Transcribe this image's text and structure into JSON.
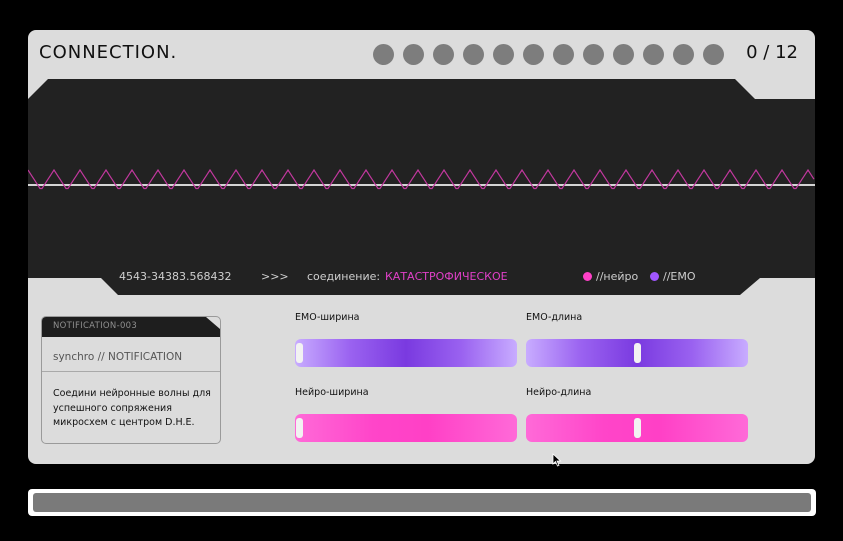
{
  "header": {
    "title": "CONNECTION.",
    "progress_dots": 12,
    "counter": "0 / 12"
  },
  "status": {
    "id": "4543-34383.568432",
    "arrows": ">>>",
    "connection_label": "соединение:",
    "connection_value": "КАТАСТРОФИЧЕСКОЕ",
    "legend": [
      {
        "label": "//нейро",
        "color": "#ff40c8"
      },
      {
        "label": "//EMO",
        "color": "#a056ff"
      }
    ]
  },
  "notification": {
    "header": "NOTIFICATION-003",
    "subtitle": "synchro // NOTIFICATION",
    "body": "Соедини нейронные волны для успешного сопряжения микросхем с центром D.H.E."
  },
  "controls": {
    "emo_width": {
      "label": "EMO-ширина",
      "value": 0.0
    },
    "emo_length": {
      "label": "EMO-длина",
      "value": 0.5
    },
    "neuro_width": {
      "label": "Нейро-ширина",
      "value": 0.0
    },
    "neuro_length": {
      "label": "Нейро-длина",
      "value": 0.5
    }
  },
  "progress": {
    "value": 0.0
  },
  "colors": {
    "accent_neuro": "#ff40c8",
    "accent_emo": "#a056ff",
    "screen_bg": "#222222",
    "panel_bg": "#dcdcdc"
  }
}
